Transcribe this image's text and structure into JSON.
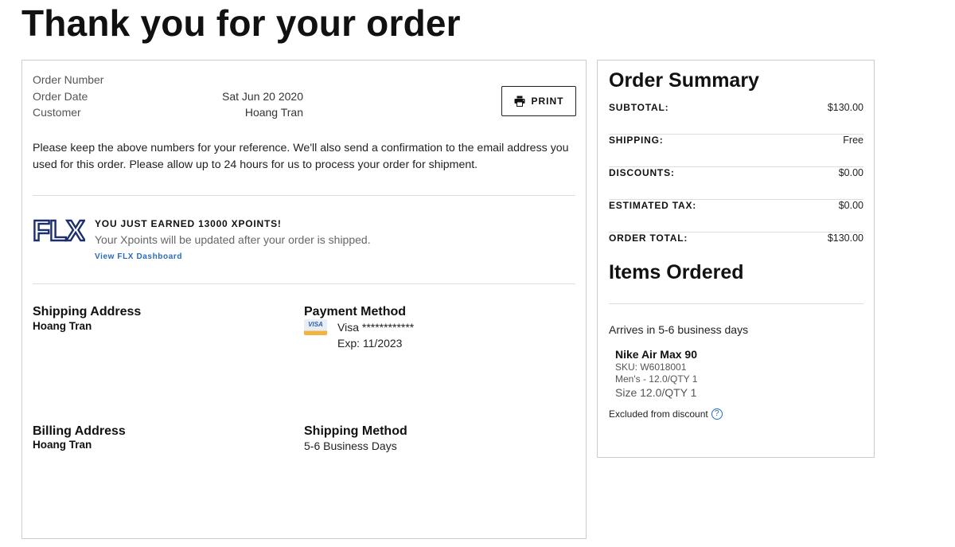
{
  "page": {
    "title": "Thank you for your order"
  },
  "order": {
    "rows": [
      {
        "label": "Order Number",
        "value": ""
      },
      {
        "label": "Order Date",
        "value": "Sat Jun 20 2020"
      },
      {
        "label": "Customer",
        "value": "Hoang Tran"
      }
    ],
    "print_label": "PRINT",
    "notice": "Please keep the above numbers for your reference. We'll also send a confirmation to the email address you used for this order. Please allow up to 24 hours for us to process your order for shipment."
  },
  "rewards": {
    "logo_text": "FLX",
    "title": "YOU JUST EARNED 13000 XPOINTS!",
    "subtitle": "Your Xpoints will be updated after your order is shipped.",
    "link": "View FLX Dashboard"
  },
  "shipping_address": {
    "heading": "Shipping Address",
    "name": "Hoang Tran"
  },
  "payment": {
    "heading": "Payment Method",
    "card_brand": "VISA",
    "card": "Visa ************",
    "exp": "Exp: 11/2023"
  },
  "billing_address": {
    "heading": "Billing Address",
    "name": "Hoang Tran"
  },
  "shipping_method": {
    "heading": "Shipping Method",
    "value": "5-6 Business Days"
  },
  "summary": {
    "title": "Order Summary",
    "rows": [
      {
        "label": "SUBTOTAL:",
        "value": "$130.00"
      },
      {
        "label": "SHIPPING:",
        "value": "Free"
      },
      {
        "label": "DISCOUNTS:",
        "value": "$0.00"
      },
      {
        "label": "ESTIMATED TAX:",
        "value": "$0.00"
      },
      {
        "label": "ORDER TOTAL:",
        "value": "$130.00"
      }
    ]
  },
  "items": {
    "title": "Items Ordered",
    "arrives": "Arrives in 5-6 business days",
    "list": [
      {
        "name": "Nike Air Max 90",
        "sku": "SKU: W6018001",
        "variant": "Men's - 12.0/QTY 1",
        "size": "Size 12.0/QTY 1"
      }
    ],
    "excluded": "Excluded from discount",
    "help_symbol": "?"
  },
  "colors": {
    "link": "#2a6bb5",
    "border": "#cccccc",
    "divider": "#dddddd"
  }
}
